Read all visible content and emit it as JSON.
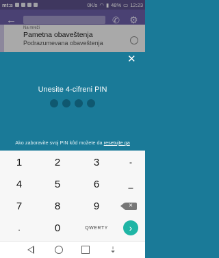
{
  "status_bar": {
    "carrier": "mt:s",
    "speed": "0K/s",
    "battery": "48%",
    "time": "12:23"
  },
  "settings_behind": {
    "section_label": "Na mreži",
    "item_title": "Pametna obaveštenja",
    "item_subtitle": "Podrazumevana obaveštenja"
  },
  "pin_dialog": {
    "title": "Unesite 4-cifreni PIN",
    "dots_filled": 0,
    "dots_total": 4,
    "forgot_text": "Ako zaboravite svoj PIN kôd možete da ",
    "reset_link": "resetujte ga"
  },
  "keypad": {
    "keys": [
      "1",
      "2",
      "3",
      "-",
      "4",
      "5",
      "6",
      "_",
      "7",
      "8",
      "9",
      ".",
      "0"
    ],
    "qwerty_label": "QWERTY",
    "backspace_glyph": "×",
    "go_glyph": "›"
  },
  "nav_bar": {
    "icons": [
      "back-icon",
      "home-icon",
      "recent-apps-icon",
      "notifications-icon"
    ]
  },
  "colors": {
    "status_bar": "#5b4f89",
    "app_bar": "#6a5da5",
    "panel": "#1a7a98",
    "dot": "#0f5870",
    "go_button": "#1fb5a5",
    "keypad_bg": "#f7f7f7"
  }
}
